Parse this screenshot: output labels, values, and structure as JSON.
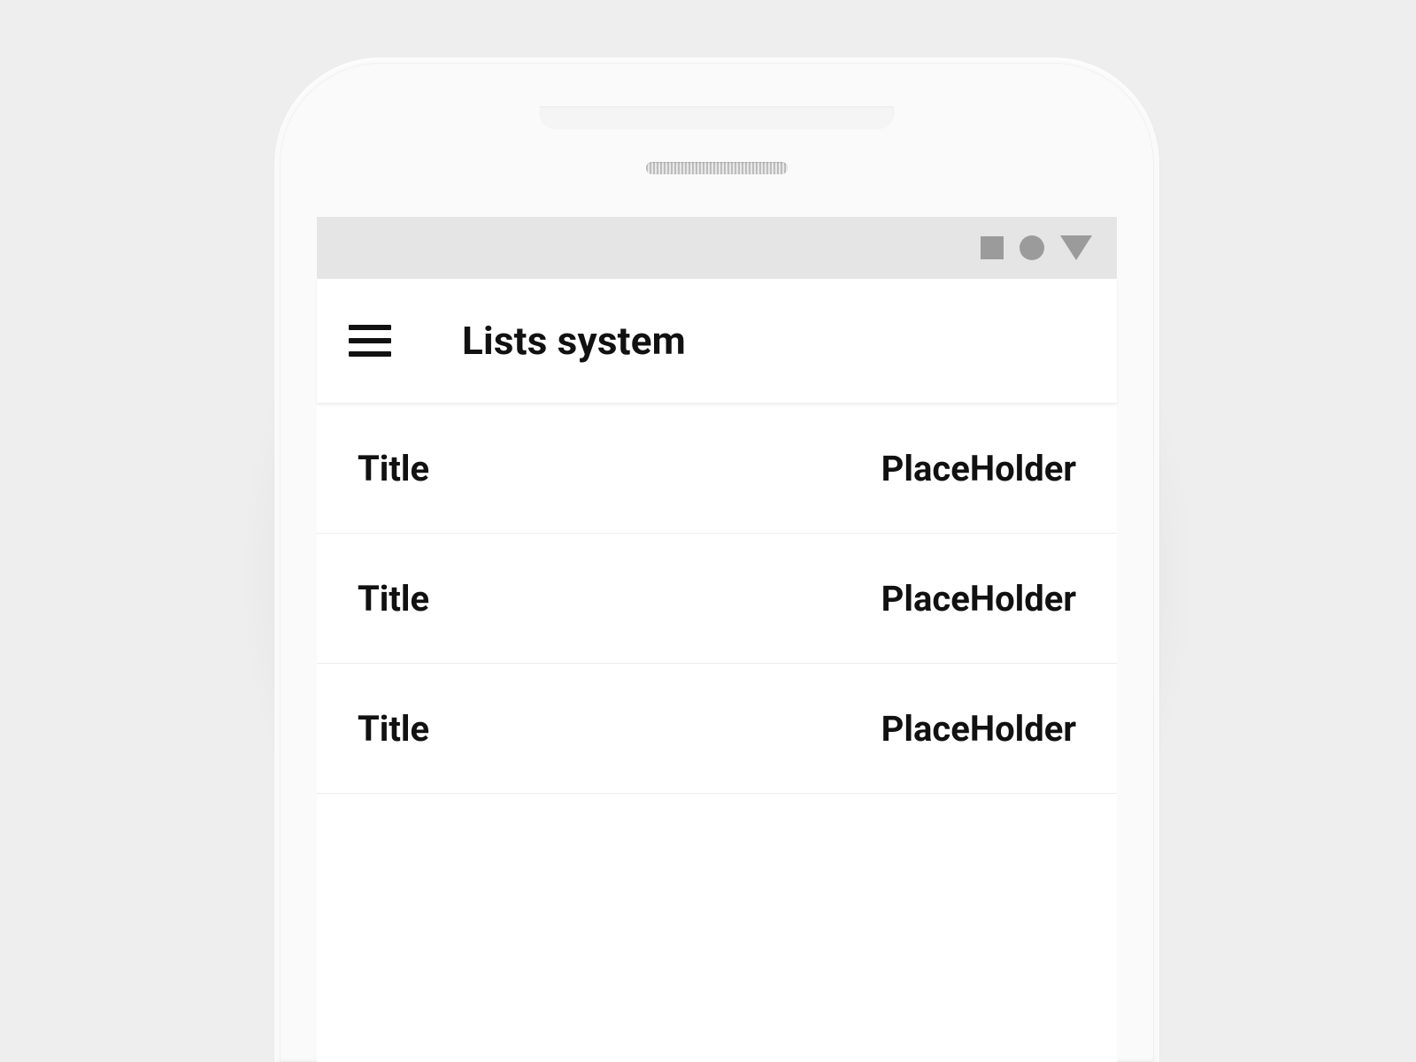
{
  "appbar": {
    "title": "Lists system"
  },
  "list": {
    "items": [
      {
        "title": "Title",
        "value": "PlaceHolder"
      },
      {
        "title": "Title",
        "value": "PlaceHolder"
      },
      {
        "title": "Title",
        "value": "PlaceHolder"
      }
    ]
  }
}
